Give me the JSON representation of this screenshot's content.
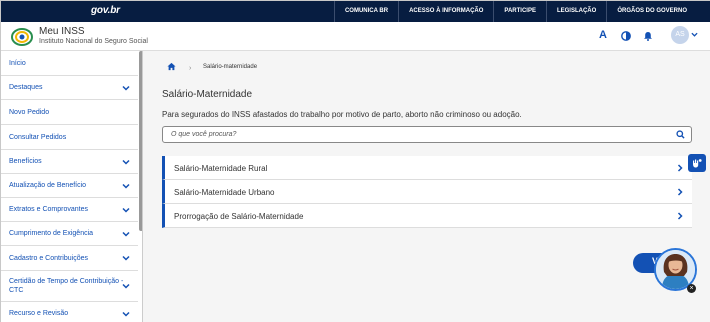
{
  "gov_bar": {
    "logo": "gov.br",
    "links": [
      "COMUNICA BR",
      "ACESSO À INFORMAÇÃO",
      "PARTICIPE",
      "LEGISLAÇÃO",
      "ÓRGÃOS DO GOVERNO"
    ]
  },
  "header": {
    "title": "Meu INSS",
    "subtitle": "Instituto Nacional do Seguro Social",
    "font_icon": "A",
    "avatar_initials": "AS"
  },
  "sidebar": {
    "items": [
      {
        "label": "Início"
      },
      {
        "label": "Destaques"
      },
      {
        "label": "Novo Pedido"
      },
      {
        "label": "Consultar Pedidos"
      },
      {
        "label": "Benefícios"
      },
      {
        "label": "Atualização de Benefício"
      },
      {
        "label": "Extratos e Comprovantes"
      },
      {
        "label": "Cumprimento de Exigência"
      },
      {
        "label": "Cadastro e Contribuições"
      },
      {
        "label": "Certidão de Tempo de Contribuição - CTC"
      },
      {
        "label": "Recurso e Revisão"
      }
    ]
  },
  "breadcrumb": {
    "current": "Salário-maternidade"
  },
  "main": {
    "title": "Salário-Maternidade",
    "description": "Para segurados do INSS afastados do trabalho por motivo de parto, aborto não criminoso ou adoção.",
    "search_placeholder": "O que você procura?",
    "options": [
      {
        "label": "Salário-Maternidade Rural"
      },
      {
        "label": "Salário-Maternidade Urbano"
      },
      {
        "label": "Prorrogação de Salário-Maternidade"
      }
    ]
  },
  "chat": {
    "pill_text": "V"
  },
  "colors": {
    "gov_bar": "#071d41",
    "accent": "#1351b4",
    "main_bg": "#f5f5f5"
  }
}
